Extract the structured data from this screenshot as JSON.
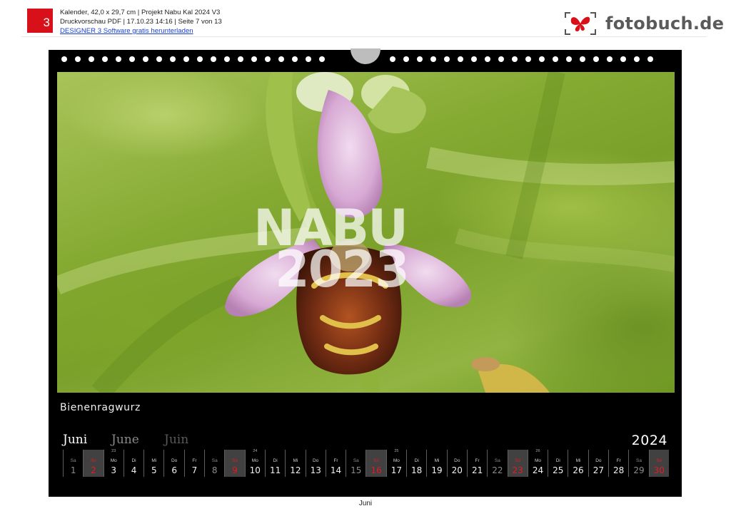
{
  "header": {
    "badge": "3",
    "line1": "Kalender, 42,0 x 29,7 cm | Projekt Nabu Kal 2024 V3",
    "line2": "Druckvorschau PDF | 17.10.23 14:16 | Seite 7 von 13",
    "link": "DESIGNER 3 Software gratis herunterladen"
  },
  "brand": {
    "name": "fotobuch.de",
    "icon": "butterfly-logo",
    "accent": "#d7101a"
  },
  "calendar": {
    "photo": {
      "subject": "Bienenragwurz",
      "watermark_l1": "NABU",
      "watermark_l2": "2023"
    },
    "caption": "Bienenragwurz",
    "month_de": "Juni",
    "month_en": "June",
    "month_fr": "Juin",
    "year": "2024",
    "days": [
      {
        "n": "1",
        "wd": "Sa",
        "t": "sat",
        "wk": ""
      },
      {
        "n": "2",
        "wd": "So",
        "t": "sun",
        "wk": ""
      },
      {
        "n": "3",
        "wd": "Mo",
        "t": "",
        "wk": "23"
      },
      {
        "n": "4",
        "wd": "Di",
        "t": "",
        "wk": ""
      },
      {
        "n": "5",
        "wd": "Mi",
        "t": "",
        "wk": ""
      },
      {
        "n": "6",
        "wd": "Do",
        "t": "",
        "wk": ""
      },
      {
        "n": "7",
        "wd": "Fr",
        "t": "",
        "wk": ""
      },
      {
        "n": "8",
        "wd": "Sa",
        "t": "sat",
        "wk": ""
      },
      {
        "n": "9",
        "wd": "So",
        "t": "sun",
        "wk": ""
      },
      {
        "n": "10",
        "wd": "Mo",
        "t": "",
        "wk": "24"
      },
      {
        "n": "11",
        "wd": "Di",
        "t": "",
        "wk": ""
      },
      {
        "n": "12",
        "wd": "Mi",
        "t": "",
        "wk": ""
      },
      {
        "n": "13",
        "wd": "Do",
        "t": "",
        "wk": ""
      },
      {
        "n": "14",
        "wd": "Fr",
        "t": "",
        "wk": ""
      },
      {
        "n": "15",
        "wd": "Sa",
        "t": "sat",
        "wk": ""
      },
      {
        "n": "16",
        "wd": "So",
        "t": "sun",
        "wk": ""
      },
      {
        "n": "17",
        "wd": "Mo",
        "t": "",
        "wk": "25"
      },
      {
        "n": "18",
        "wd": "Di",
        "t": "",
        "wk": ""
      },
      {
        "n": "19",
        "wd": "Mi",
        "t": "",
        "wk": ""
      },
      {
        "n": "20",
        "wd": "Do",
        "t": "",
        "wk": ""
      },
      {
        "n": "21",
        "wd": "Fr",
        "t": "",
        "wk": ""
      },
      {
        "n": "22",
        "wd": "Sa",
        "t": "sat",
        "wk": ""
      },
      {
        "n": "23",
        "wd": "So",
        "t": "sun",
        "wk": ""
      },
      {
        "n": "24",
        "wd": "Mo",
        "t": "",
        "wk": "26"
      },
      {
        "n": "25",
        "wd": "Di",
        "t": "",
        "wk": ""
      },
      {
        "n": "26",
        "wd": "Mi",
        "t": "",
        "wk": ""
      },
      {
        "n": "27",
        "wd": "Do",
        "t": "",
        "wk": ""
      },
      {
        "n": "28",
        "wd": "Fr",
        "t": "",
        "wk": ""
      },
      {
        "n": "29",
        "wd": "Sa",
        "t": "sat",
        "wk": ""
      },
      {
        "n": "30",
        "wd": "So",
        "t": "sun",
        "wk": ""
      }
    ]
  },
  "footer": {
    "label": "Juni"
  }
}
